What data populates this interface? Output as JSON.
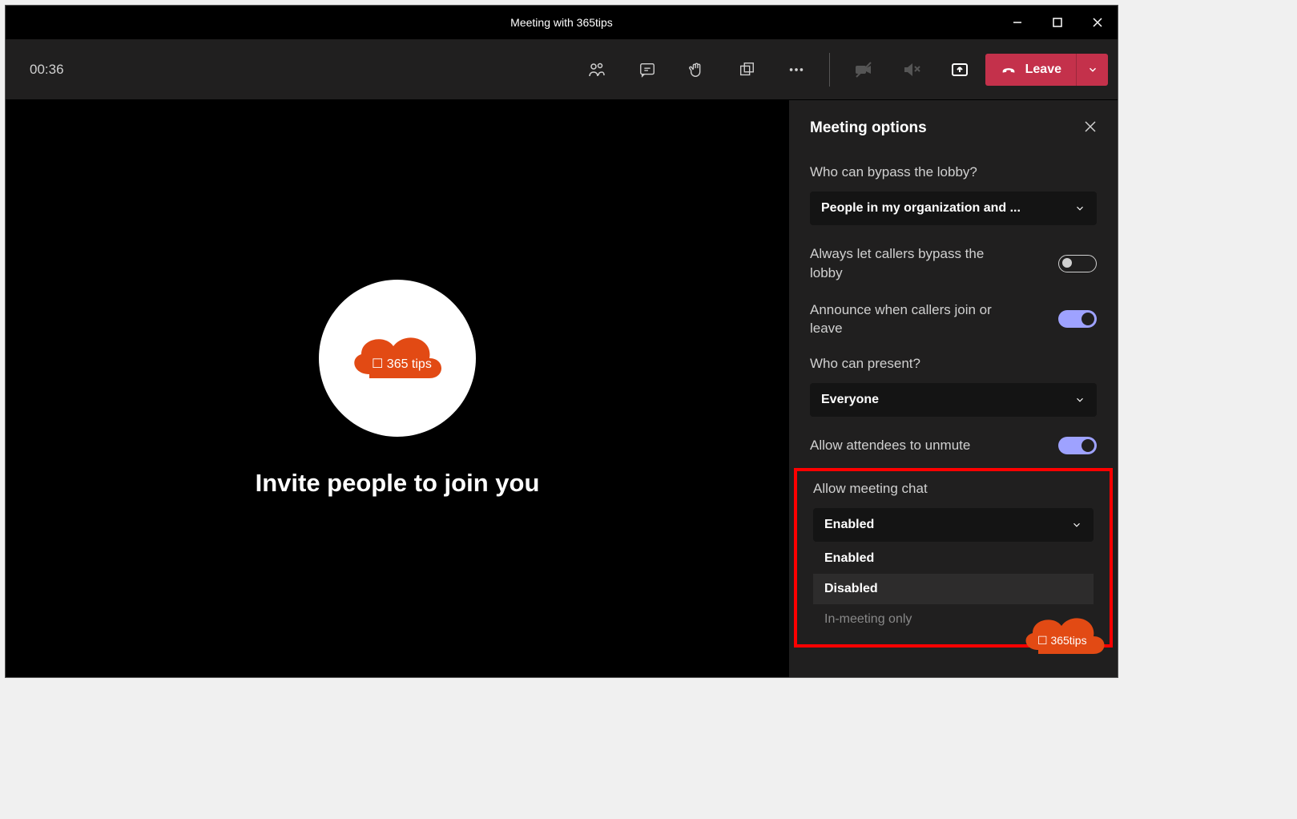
{
  "window": {
    "title": "Meeting with 365tips"
  },
  "toolbar": {
    "timer": "00:36",
    "leave_label": "Leave"
  },
  "stage": {
    "invite_text": "Invite people to join you",
    "avatar_label": "365 tips"
  },
  "panel": {
    "title": "Meeting options",
    "lobby_label": "Who can bypass the lobby?",
    "lobby_value": "People in my organization and ...",
    "callers_bypass_label": "Always let callers bypass the lobby",
    "announce_label": "Announce when callers join or leave",
    "present_label": "Who can present?",
    "present_value": "Everyone",
    "unmute_label": "Allow attendees to unmute",
    "chat_label": "Allow meeting chat",
    "chat_value": "Enabled",
    "chat_options": [
      "Enabled",
      "Disabled",
      "In-meeting only"
    ]
  },
  "branding_text": "365tips"
}
